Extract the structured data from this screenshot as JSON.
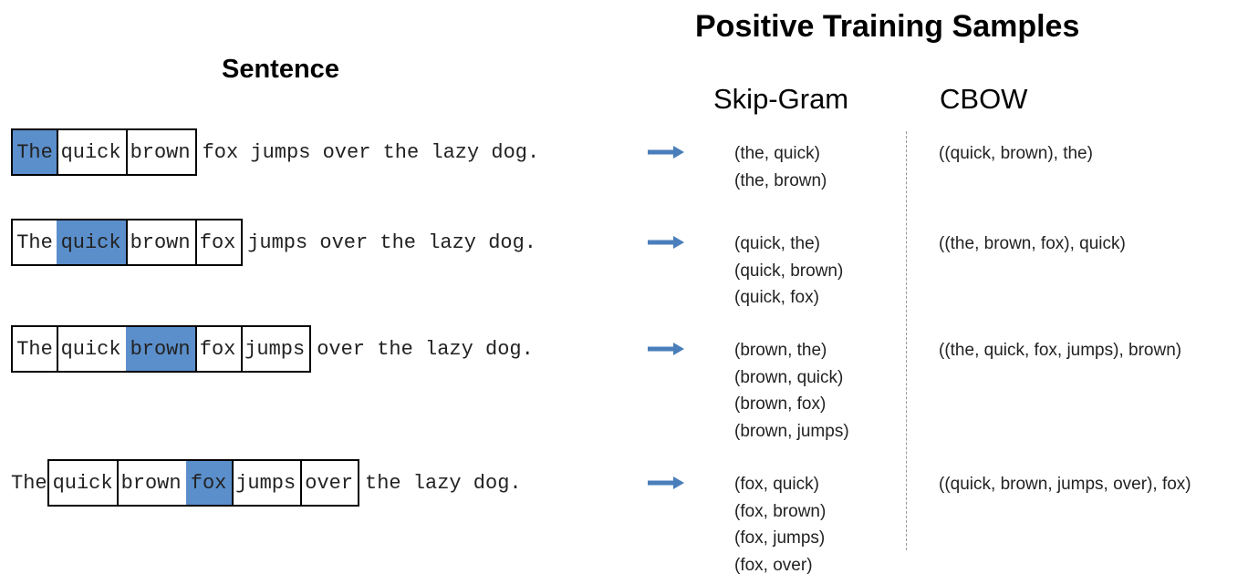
{
  "title": "Positive Training Samples",
  "sentence_heading": "Sentence",
  "column_headers": {
    "skipgram": "Skip-Gram",
    "cbow": "CBOW"
  },
  "colors": {
    "target": "#5b8fcc",
    "arrow": "#4a7ebb",
    "box_border": "#000000"
  },
  "rows": [
    {
      "tokens": [
        "The",
        "quick",
        "brown",
        "fox",
        "jumps",
        "over",
        "the",
        "lazy",
        "dog."
      ],
      "target_index": 0,
      "window": [
        0,
        2
      ],
      "skipgram": [
        "(the, quick)",
        "(the, brown)"
      ],
      "cbow": "((quick, brown), the)"
    },
    {
      "tokens": [
        "The",
        "quick",
        "brown",
        "fox",
        "jumps",
        "over",
        "the",
        "lazy",
        "dog."
      ],
      "target_index": 1,
      "window": [
        0,
        3
      ],
      "skipgram": [
        "(quick, the)",
        "(quick, brown)",
        "(quick, fox)"
      ],
      "cbow": "((the, brown, fox), quick)"
    },
    {
      "tokens": [
        "The",
        "quick",
        "brown",
        "fox",
        "jumps",
        "over",
        "the",
        "lazy",
        "dog."
      ],
      "target_index": 2,
      "window": [
        0,
        4
      ],
      "skipgram": [
        "(brown, the)",
        "(brown, quick)",
        "(brown, fox)",
        "(brown, jumps)"
      ],
      "cbow": "((the, quick, fox, jumps), brown)"
    },
    {
      "tokens": [
        "The",
        "quick",
        "brown",
        "fox",
        "jumps",
        "over",
        "the",
        "lazy",
        "dog."
      ],
      "target_index": 3,
      "window": [
        1,
        5
      ],
      "skipgram": [
        "(fox, quick)",
        "(fox, brown)",
        "(fox, jumps)",
        "(fox, over)"
      ],
      "cbow": "((quick, brown, jumps, over), fox)"
    }
  ]
}
